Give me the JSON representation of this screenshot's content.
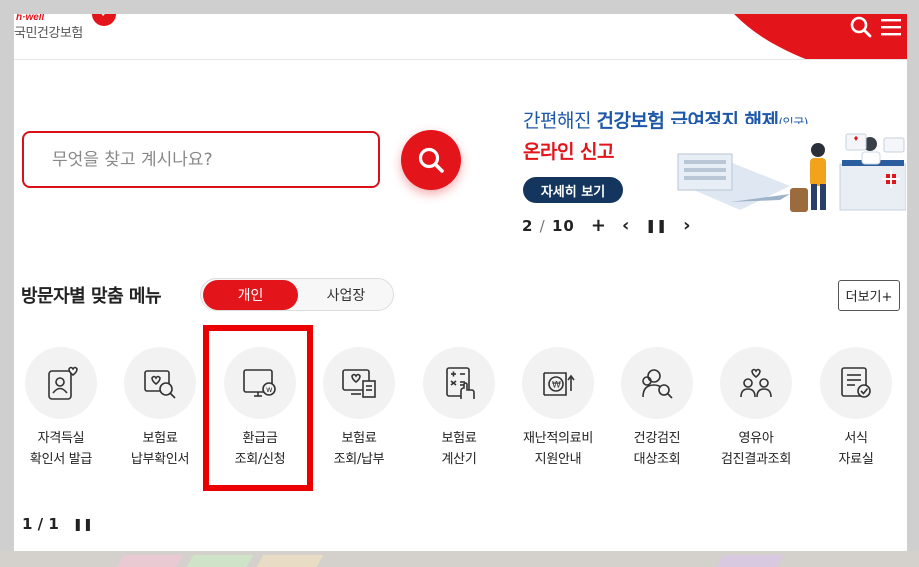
{
  "header": {
    "logo_sub": "h·well",
    "logo_text": "국민건강보험"
  },
  "search": {
    "placeholder": "무엇을 찾고 계시나요?"
  },
  "banner": {
    "line1_light": "간편해진 ",
    "line1_bold": "건강보험 급여정지 해제",
    "line1_small": "(입국)",
    "line2": "온라인 신고",
    "button_label": "자세히 보기",
    "current": "2",
    "sep": "/",
    "total": "10",
    "add": "+",
    "prev": "‹",
    "pause": "❚❚",
    "next": "›"
  },
  "visitor_menu": {
    "title": "방문자별 맞춤 메뉴",
    "tab_personal": "개인",
    "tab_business": "사업장",
    "more_label": "더보기+",
    "items": [
      {
        "line1": "자격득실",
        "line2": "확인서 발급",
        "icon": "id-card-heart-icon"
      },
      {
        "line1": "보험료",
        "line2": "납부확인서",
        "icon": "heart-search-icon"
      },
      {
        "line1": "환급금",
        "line2": "조회/신청",
        "icon": "monitor-won-icon"
      },
      {
        "line1": "보험료",
        "line2": "조회/납부",
        "icon": "monitor-document-icon"
      },
      {
        "line1": "보험료",
        "line2": "계산기",
        "icon": "calculator-hand-icon"
      },
      {
        "line1": "재난적의료비",
        "line2": "지원안내",
        "icon": "won-support-icon"
      },
      {
        "line1": "건강검진",
        "line2": "대상조회",
        "icon": "people-search-icon"
      },
      {
        "line1": "영유아",
        "line2": "검진결과조회",
        "icon": "family-heart-icon"
      },
      {
        "line1": "서식",
        "line2": "자료실",
        "icon": "form-document-icon"
      }
    ],
    "page": "1 / 1",
    "pause": "❚❚"
  },
  "colors": {
    "brand_red": "#e4141b",
    "banner_blue": "#1d57a8",
    "banner_navy": "#13355e",
    "highlight": "#ea0000"
  }
}
